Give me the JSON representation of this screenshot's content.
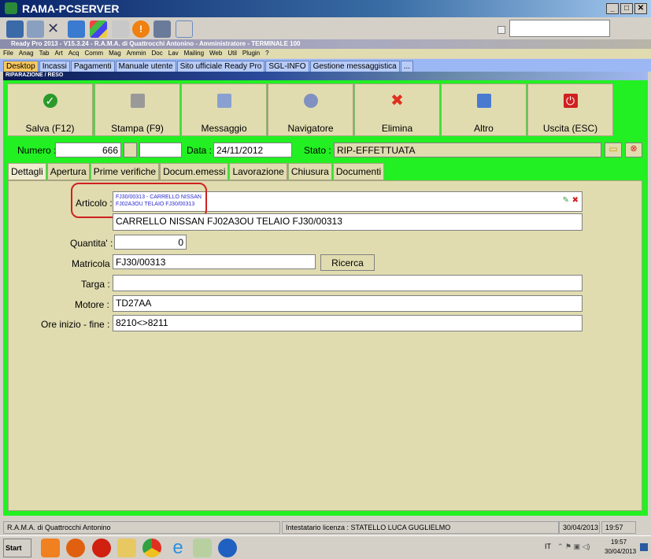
{
  "window": {
    "title": "RAMA-PCSERVER"
  },
  "app_title": "Ready Pro 2013 - V15.3.24 - R.A.M.A. di Quattrocchi Antonino - Amministratore - TERMINALE 100",
  "menu": [
    "File",
    "Anag",
    "Tab",
    "Art",
    "Acq",
    "Comm",
    "Mag",
    "Ammin",
    "Doc",
    "Lav",
    "Mailing",
    "Web",
    "Util",
    "Plugin",
    "?"
  ],
  "tabs": [
    "Desktop",
    "Incassi",
    "Pagamenti",
    "Manuale utente",
    "Sito ufficiale Ready Pro",
    "SGL-INFO",
    "Gestione messaggistica",
    "..."
  ],
  "section_title": "RIPARAZIONE / RESO",
  "actions": [
    "Salva (F12)",
    "Stampa (F9)",
    "Messaggio",
    "Navigatore",
    "Elimina",
    "Altro",
    "Uscita (ESC)"
  ],
  "header": {
    "numero_label": "Numero :",
    "numero": "666",
    "data_label": "Data :",
    "data": "24/11/2012",
    "stato_label": "Stato :",
    "stato": "RIP-EFFETTUATA"
  },
  "form_tabs": [
    "Dettagli",
    "Apertura",
    "Prime verifiche",
    "Docum.emessi",
    "Lavorazione",
    "Chiusura",
    "Documenti"
  ],
  "form": {
    "articolo_label": "Articolo :",
    "articolo_line1": "FJ30/00313 - CARRELLO NISSAN",
    "articolo_line2": "FJ02A3OU TELAIO FJ30/00313",
    "descrizione": "CARRELLO NISSAN FJ02A3OU TELAIO FJ30/00313",
    "quantita_label": "Quantita' :",
    "quantita": "0",
    "matricola_label": "Matricola :",
    "matricola": "FJ30/00313",
    "ricerca": "Ricerca",
    "targa_label": "Targa :",
    "targa": "",
    "motore_label": "Motore :",
    "motore": "TD27AA",
    "ore_label": "Ore inizio - fine :",
    "ore": "8210<>8211"
  },
  "status": {
    "company": "R.A.M.A. di Quattrocchi Antonino",
    "license": "Intestatario licenza : STATELLO LUCA GUGLIELMO",
    "date": "30/04/2013",
    "time": "19:57"
  },
  "taskbar": {
    "start": "Start",
    "lang": "IT",
    "time": "19:57",
    "date": "30/04/2013"
  }
}
